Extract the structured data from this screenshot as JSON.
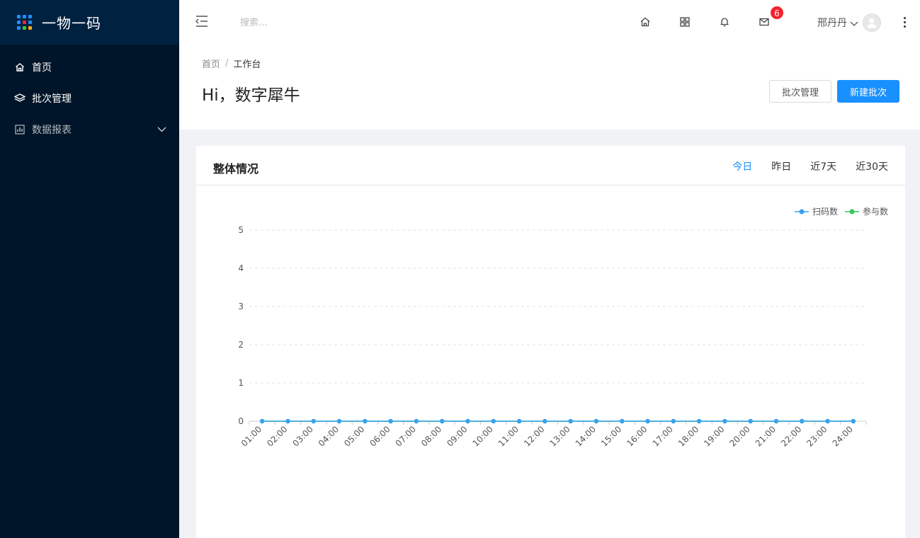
{
  "app": {
    "name": "一物一码"
  },
  "sidebar": {
    "items": [
      {
        "label": "首页",
        "icon": "home-icon"
      },
      {
        "label": "批次管理",
        "icon": "layers-icon"
      },
      {
        "label": "数据报表",
        "icon": "bar-chart-icon"
      }
    ]
  },
  "header": {
    "search_placeholder": "搜索...",
    "mail_badge": "6",
    "user_name": "邢丹丹"
  },
  "breadcrumb": {
    "home": "首页",
    "sep": "/",
    "current": "工作台"
  },
  "page": {
    "title": "Hi，数字犀牛",
    "btn_batch": "批次管理",
    "btn_new": "新建批次"
  },
  "card": {
    "title": "整体情况",
    "tabs": [
      "今日",
      "昨日",
      "近7天",
      "近30天"
    ]
  },
  "colors": {
    "accent": "#1890ff",
    "series_scan": "#3aa0ef",
    "series_join": "#34c759",
    "sidebar_bg": "#001529"
  },
  "chart_data": {
    "type": "line",
    "categories": [
      "01:00",
      "02:00",
      "03:00",
      "04:00",
      "05:00",
      "06:00",
      "07:00",
      "08:00",
      "09:00",
      "10:00",
      "11:00",
      "12:00",
      "13:00",
      "14:00",
      "15:00",
      "16:00",
      "17:00",
      "18:00",
      "19:00",
      "20:00",
      "21:00",
      "22:00",
      "23:00",
      "24:00"
    ],
    "series": [
      {
        "name": "扫码数",
        "values": [
          0,
          0,
          0,
          0,
          0,
          0,
          0,
          0,
          0,
          0,
          0,
          0,
          0,
          0,
          0,
          0,
          0,
          0,
          0,
          0,
          0,
          0,
          0,
          0
        ]
      },
      {
        "name": "参与数",
        "values": [
          0,
          0,
          0,
          0,
          0,
          0,
          0,
          0,
          0,
          0,
          0,
          0,
          0,
          0,
          0,
          0,
          0,
          0,
          0,
          0,
          0,
          0,
          0,
          0
        ]
      }
    ],
    "y_ticks": [
      0,
      1,
      2,
      3,
      4,
      5
    ],
    "ylim": [
      0,
      5
    ],
    "grid": true,
    "legend": "top-right"
  }
}
